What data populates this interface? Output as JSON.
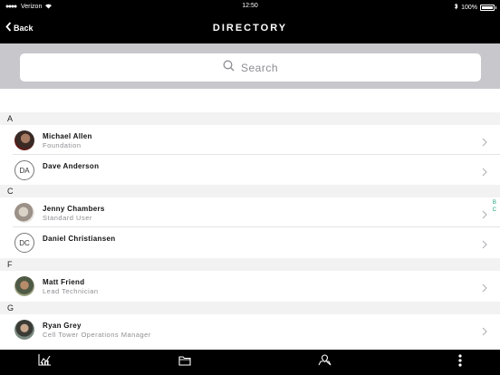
{
  "status_bar": {
    "carrier": "Verizon",
    "time": "12:50",
    "battery": "100%",
    "battery_level": 1.0
  },
  "nav": {
    "back_label": "Back",
    "title": "DIRECTORY"
  },
  "search": {
    "placeholder": "Search"
  },
  "sections": [
    {
      "letter": "A",
      "rows": [
        {
          "name": "Michael Allen",
          "subtitle": "Foundation",
          "avatar": "photo"
        },
        {
          "name": "Dave Anderson",
          "subtitle": "",
          "avatar": "DA"
        }
      ]
    },
    {
      "letter": "C",
      "rows": [
        {
          "name": "Jenny Chambers",
          "subtitle": "Standard User",
          "avatar": "photo"
        },
        {
          "name": "Daniel Christiansen",
          "subtitle": "",
          "avatar": "DC"
        }
      ]
    },
    {
      "letter": "F",
      "rows": [
        {
          "name": "Matt Friend",
          "subtitle": "Lead Technician",
          "avatar": "photo"
        }
      ]
    },
    {
      "letter": "G",
      "rows": [
        {
          "name": "Ryan Grey",
          "subtitle": "Cell Tower Operations Manager",
          "avatar": "photo"
        }
      ]
    }
  ],
  "section_index": [
    "B",
    "C"
  ],
  "tab_bar": {
    "tabs": [
      "chart-icon",
      "folder-icon",
      "map-icon",
      "more-icon"
    ]
  },
  "colors": {
    "accent": "#1aa37e",
    "nav_bg": "#000000",
    "search_bg": "#c8c7cc",
    "section_bg": "#f2f2f2"
  }
}
